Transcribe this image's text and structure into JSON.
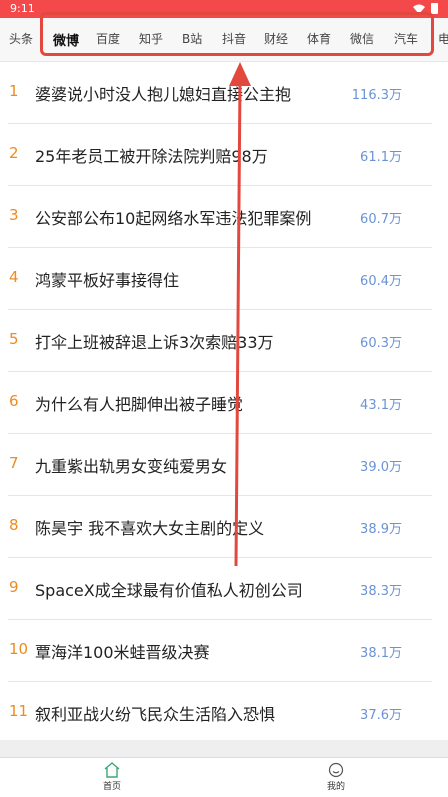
{
  "status_bar": {
    "time": "9:11"
  },
  "tabs": [
    "头条",
    "微博",
    "百度",
    "知乎",
    "B站",
    "抖音",
    "财经",
    "体育",
    "微信",
    "汽车",
    "电"
  ],
  "list": [
    {
      "rank": "1",
      "title": "婆婆说小时没人抱儿媳妇直接公主抱",
      "count": "116.3万"
    },
    {
      "rank": "2",
      "title": "25年老员工被开除法院判赔98万",
      "count": "61.1万"
    },
    {
      "rank": "3",
      "title": "公安部公布10起网络水军违法犯罪案例",
      "count": "60.7万"
    },
    {
      "rank": "4",
      "title": "鸿蒙平板好事接得住",
      "count": "60.4万"
    },
    {
      "rank": "5",
      "title": "打伞上班被辞退上诉3次索赔33万",
      "count": "60.3万"
    },
    {
      "rank": "6",
      "title": "为什么有人把脚伸出被子睡觉",
      "count": "43.1万"
    },
    {
      "rank": "7",
      "title": "九重紫出轨男女变纯爱男女",
      "count": "39.0万"
    },
    {
      "rank": "8",
      "title": "陈昊宇 我不喜欢大女主剧的定义",
      "count": "38.9万"
    },
    {
      "rank": "9",
      "title": "SpaceX成全球最有价值私人初创公司",
      "count": "38.3万"
    },
    {
      "rank": "10",
      "title": "覃海洋100米蛙晋级决赛",
      "count": "38.1万"
    },
    {
      "rank": "11",
      "title": "叙利亚战火纷飞民众生活陷入恐惧",
      "count": "37.6万"
    }
  ],
  "bottom_nav": {
    "home_label": "首页",
    "mine_label": "我的"
  },
  "colors": {
    "status_bar": "#f4494a",
    "rank": "#ef8a1f",
    "count": "#6a93d6",
    "annotation": "#e3483f"
  }
}
